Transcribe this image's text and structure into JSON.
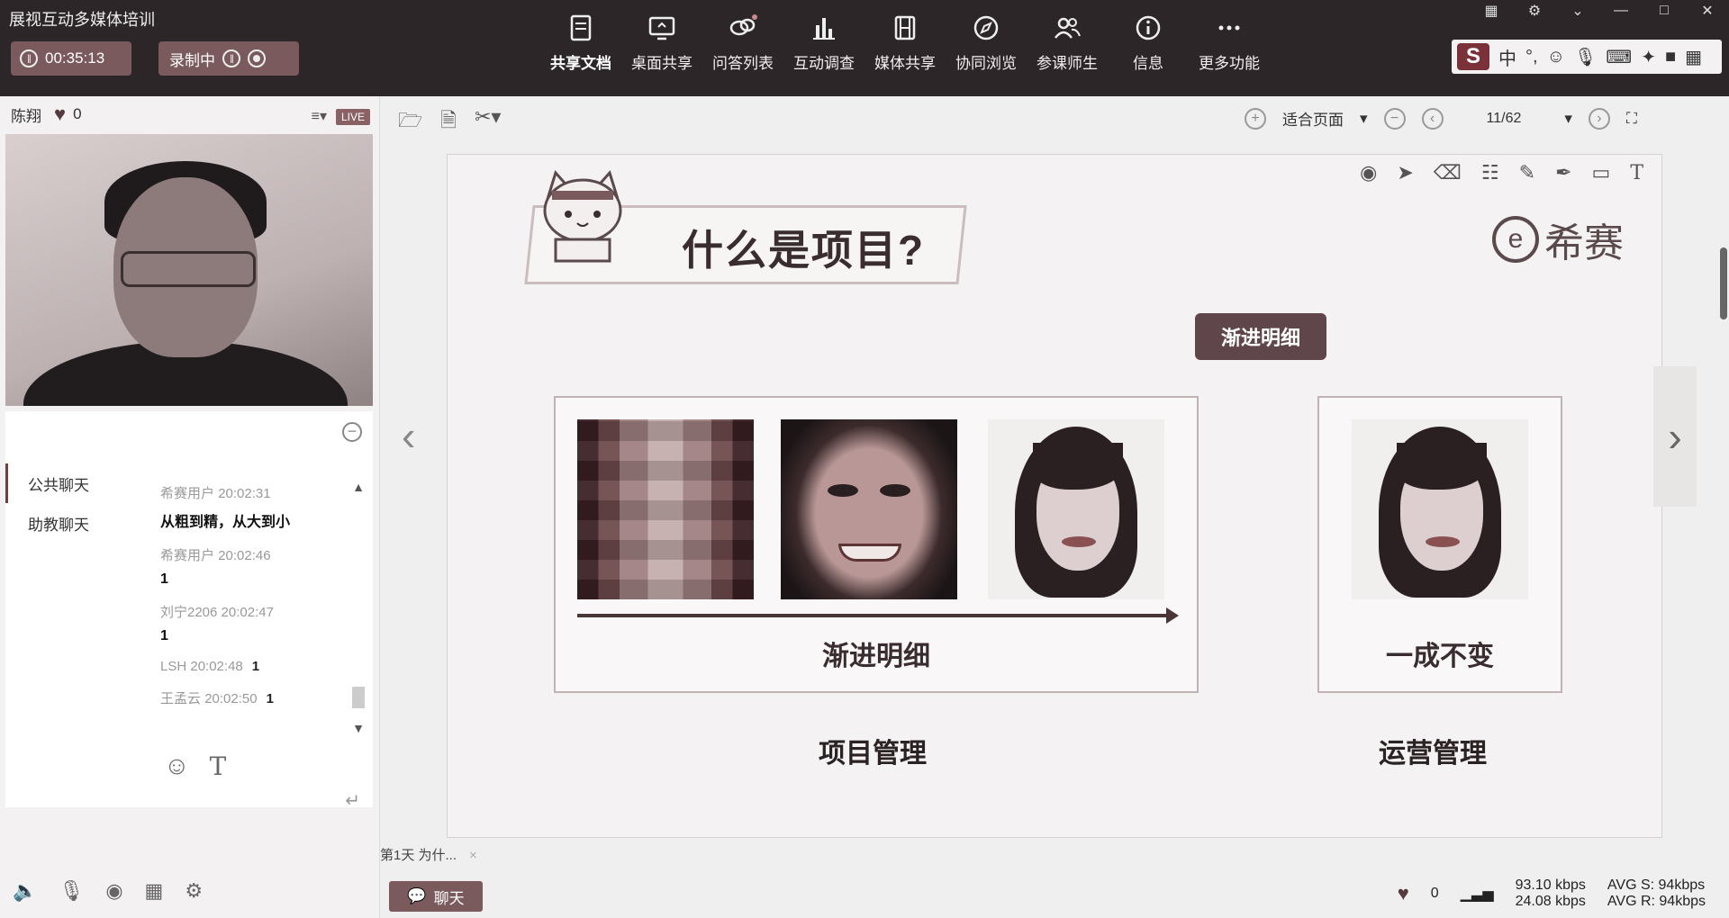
{
  "app": {
    "title": "展视互动多媒体培训"
  },
  "session": {
    "timer": "00:35:13",
    "recording_label": "录制中"
  },
  "toolbar": {
    "tools": [
      {
        "label": "共享文档",
        "icon": "document-share-icon"
      },
      {
        "label": "桌面共享",
        "icon": "desktop-share-icon"
      },
      {
        "label": "问答列表",
        "icon": "qa-list-icon"
      },
      {
        "label": "互动调查",
        "icon": "survey-chart-icon"
      },
      {
        "label": "媒体共享",
        "icon": "media-film-icon"
      },
      {
        "label": "协同浏览",
        "icon": "compass-icon"
      },
      {
        "label": "参课师生",
        "icon": "users-icon"
      },
      {
        "label": "信息",
        "icon": "info-icon"
      },
      {
        "label": "更多功能",
        "icon": "more-dots-icon"
      }
    ]
  },
  "ime": {
    "mode": "中",
    "punct": "°,"
  },
  "teacher": {
    "name": "陈翔",
    "likes": "0",
    "live_badge": "LIVE"
  },
  "chat": {
    "tabs": [
      {
        "label": "公共聊天"
      },
      {
        "label": "助教聊天"
      }
    ],
    "messages": [
      {
        "user": "希赛用户",
        "time": "20:02:31",
        "text": "从粗到精，从大到小",
        "inline": ""
      },
      {
        "user": "希赛用户",
        "time": "20:02:46",
        "text": "1",
        "inline": ""
      },
      {
        "user": "刘宁2206",
        "time": "20:02:47",
        "text": "1",
        "inline": ""
      },
      {
        "user": "LSH",
        "time": "20:02:48",
        "text": "",
        "inline": "1"
      },
      {
        "user": "王孟云",
        "time": "20:02:50",
        "text": "",
        "inline": "1"
      }
    ]
  },
  "viewer": {
    "fit_label": "适合页面",
    "page": "11/62"
  },
  "slide": {
    "title": "什么是项目?",
    "brand": "希赛",
    "tag": "渐进明细",
    "box1_label": "渐进明细",
    "box2_label": "一成不变",
    "bottom_left": "项目管理",
    "bottom_right": "运营管理"
  },
  "doc_tab": {
    "label": "第1天 为什...",
    "close": "×"
  },
  "chat_button": {
    "label": "聊天"
  },
  "stats": {
    "likes": "0",
    "up": "93.10 kbps",
    "down": "24.08 kbps",
    "avg_s": "AVG S: 94kbps",
    "avg_r": "AVG R: 94kbps"
  }
}
